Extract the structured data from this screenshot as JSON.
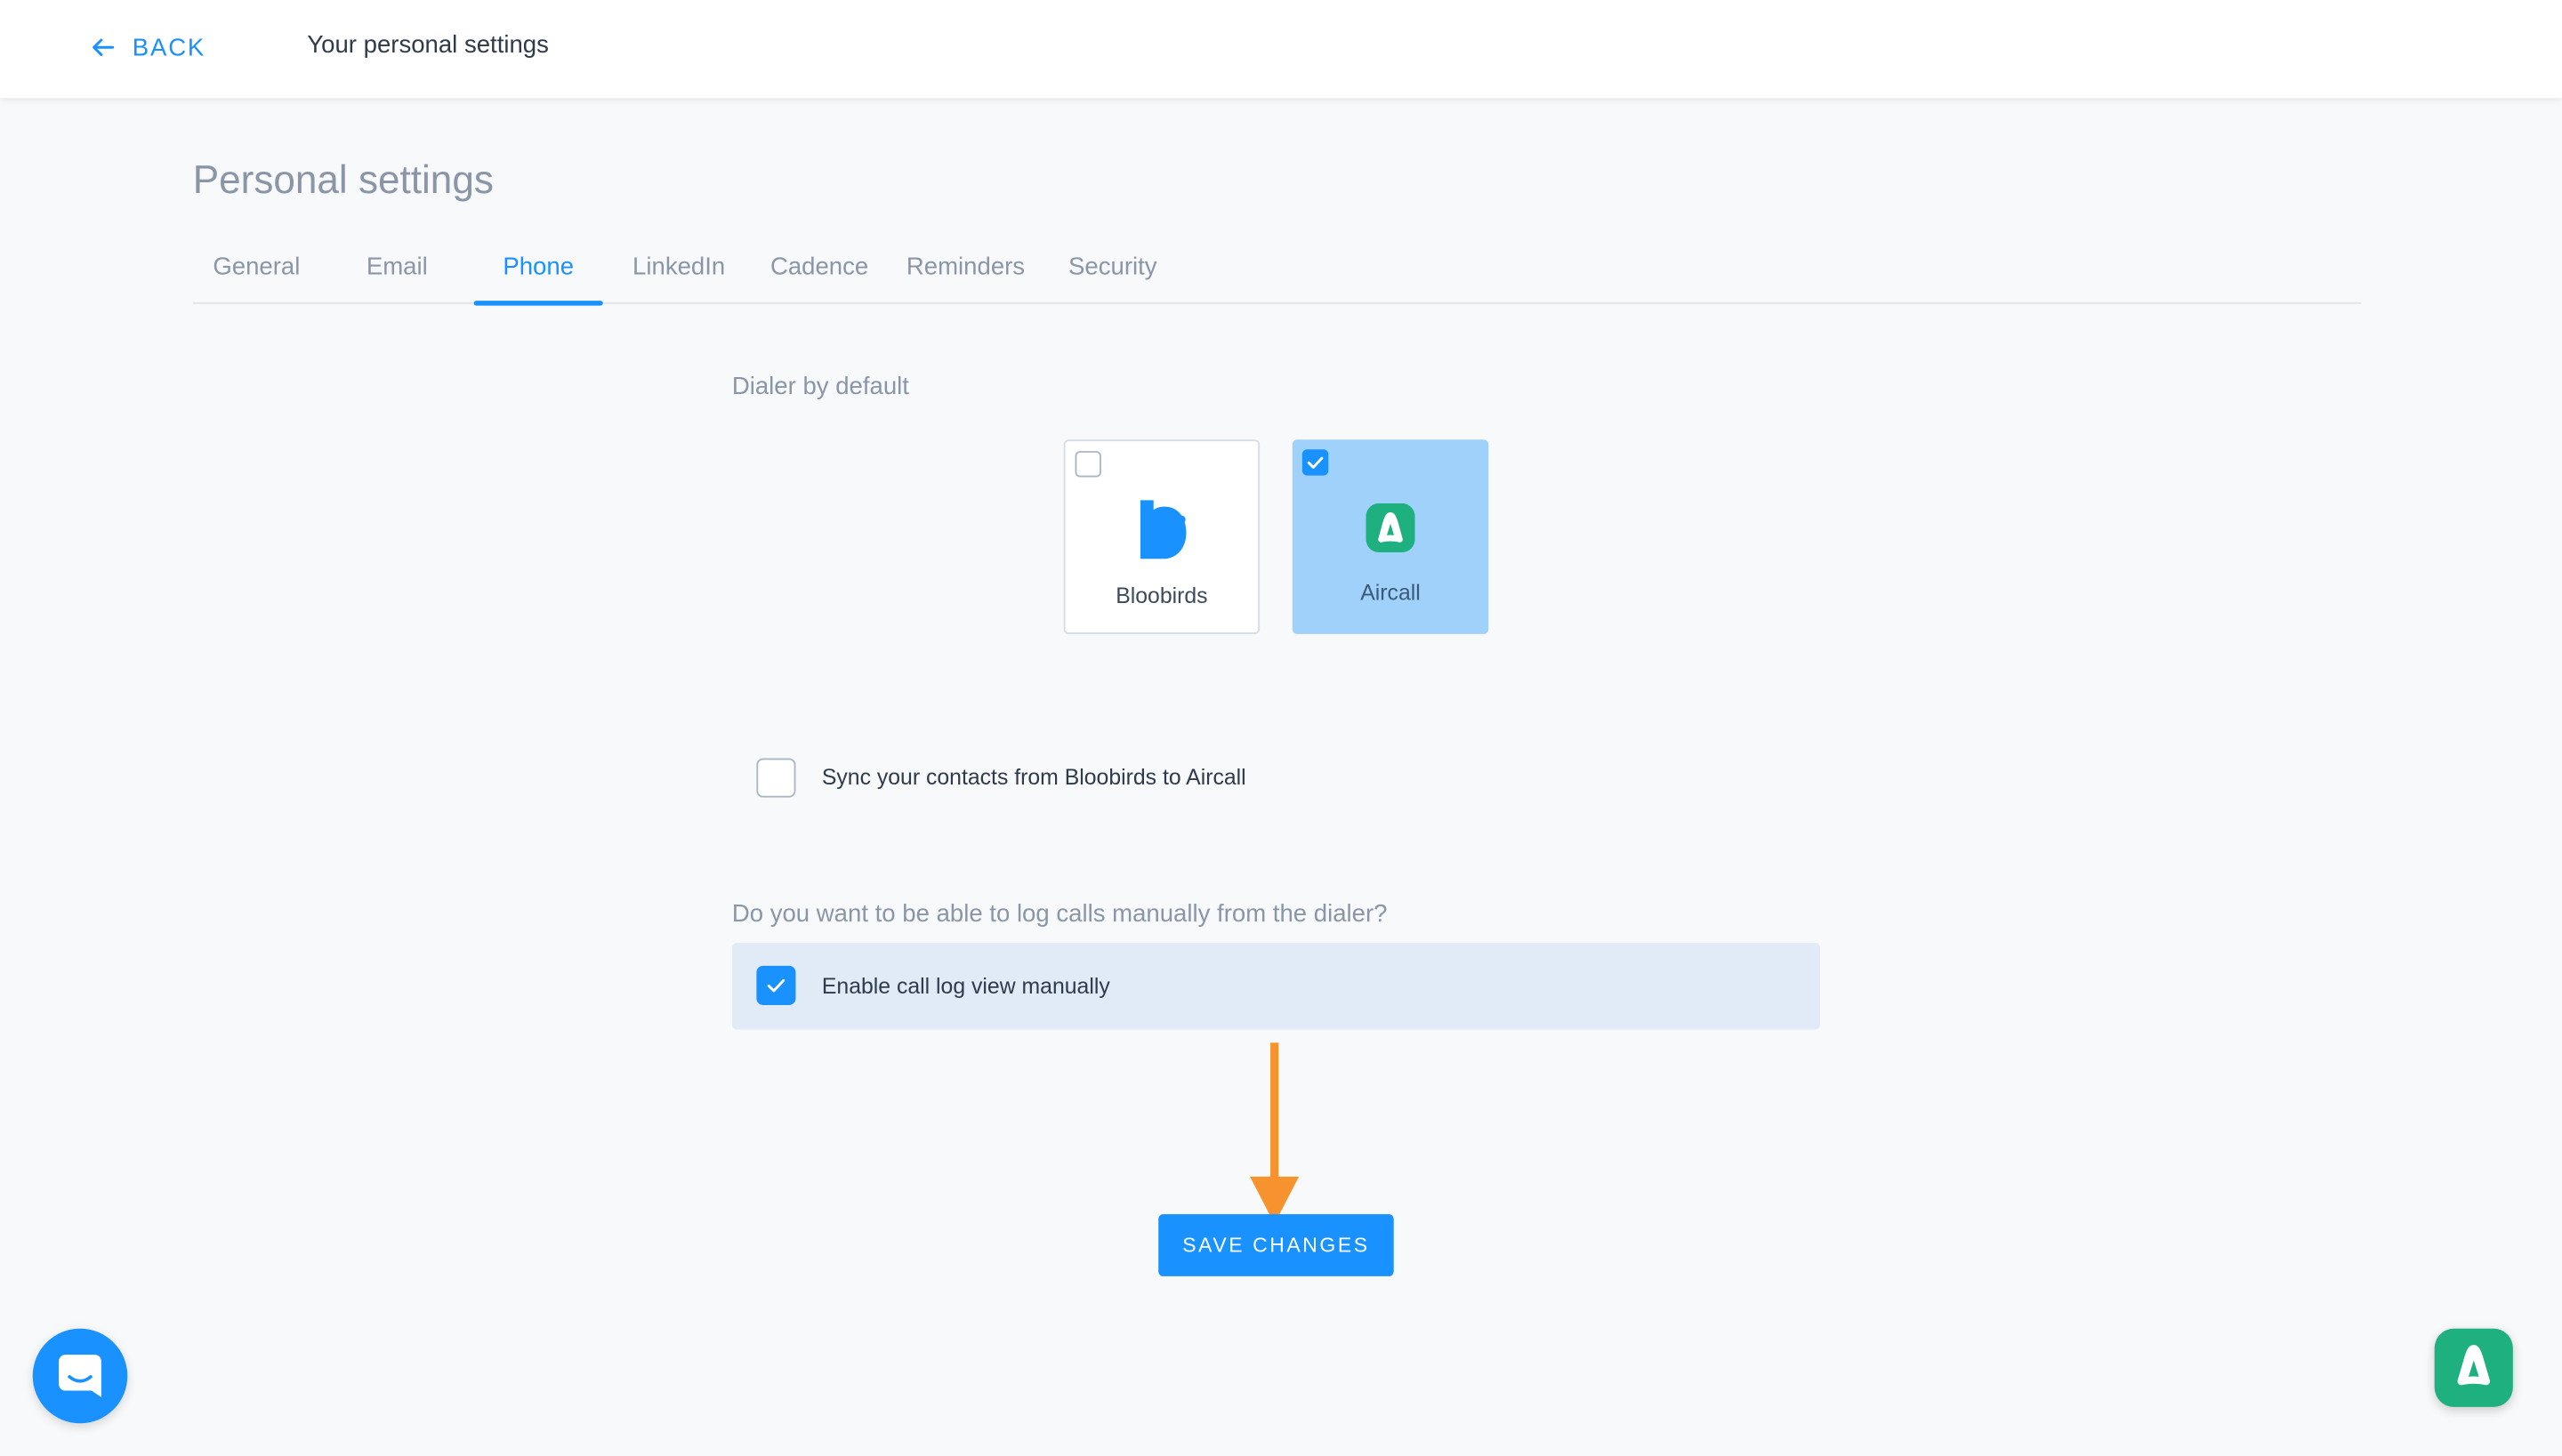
{
  "header": {
    "back_label": "BACK",
    "title": "Your personal settings"
  },
  "page": {
    "title": "Personal settings"
  },
  "tabs": [
    {
      "label": "General",
      "active": false
    },
    {
      "label": "Email",
      "active": false
    },
    {
      "label": "Phone",
      "active": true
    },
    {
      "label": "LinkedIn",
      "active": false
    },
    {
      "label": "Cadence",
      "active": false
    },
    {
      "label": "Reminders",
      "active": false
    },
    {
      "label": "Security",
      "active": false
    }
  ],
  "dialer": {
    "label": "Dialer by default",
    "options": [
      {
        "name": "Bloobirds",
        "selected": false,
        "icon": "bloobirds-logo-icon"
      },
      {
        "name": "Aircall",
        "selected": true,
        "icon": "aircall-logo-icon"
      }
    ]
  },
  "sync": {
    "label": "Sync your contacts from Bloobirds to Aircall",
    "checked": false
  },
  "call_log": {
    "question": "Do you want to be able to log calls manually from the dialer?",
    "option_label": "Enable call log view manually",
    "checked": true
  },
  "actions": {
    "save_label": "SAVE CHANGES"
  },
  "widgets": {
    "chat_icon": "chat-bubble-icon",
    "aircall_icon": "aircall-logo-icon"
  },
  "colors": {
    "accent": "#1991ff",
    "selected_card": "#9fd1fb",
    "aircall_green": "#1fb07f",
    "annotation_arrow": "#f7932e"
  }
}
